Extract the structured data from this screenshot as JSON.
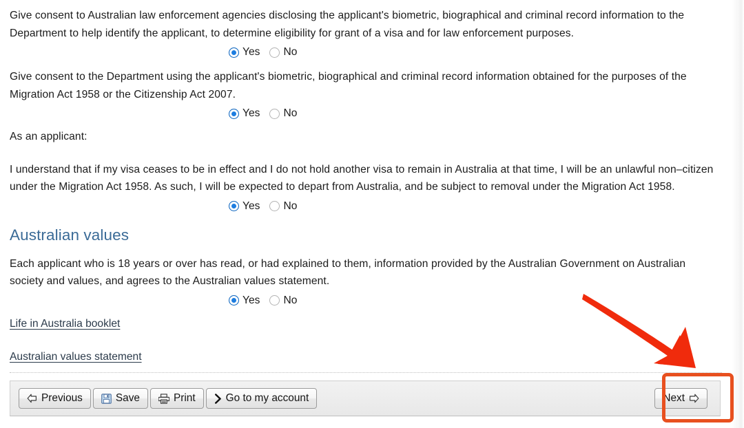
{
  "form": {
    "questions": [
      {
        "id": "consent-law-enforcement",
        "text": "Give consent to Australian law enforcement agencies disclosing the applicant's biometric, biographical and criminal record information to the Department to help identify the applicant, to determine eligibility for grant of a visa and for law enforcement purposes.",
        "options": [
          {
            "label": "Yes",
            "selected": true
          },
          {
            "label": "No",
            "selected": false
          }
        ]
      },
      {
        "id": "consent-department-use",
        "text": "Give consent to the Department using the applicant's biometric, biographical and criminal record information obtained for the purposes of the Migration Act 1958 or the Citizenship Act 2007.",
        "options": [
          {
            "label": "Yes",
            "selected": true
          },
          {
            "label": "No",
            "selected": false
          }
        ]
      }
    ],
    "applicant_intro": "As an applicant:",
    "declaration": {
      "id": "unlawful-non-citizen-declaration",
      "text": "I understand that if my visa ceases to be in effect and I do not hold another visa to remain in Australia at that time, I will be an unlawful non–citizen under the Migration Act 1958. As such, I will be expected to depart from Australia, and be subject to removal under the Migration Act 1958.",
      "options": [
        {
          "label": "Yes",
          "selected": true
        },
        {
          "label": "No",
          "selected": false
        }
      ]
    },
    "australian_values": {
      "heading": "Australian values",
      "text": "Each applicant who is 18 years or over has read, or had explained to them, information provided by the Australian Government on Australian society and values, and agrees to the Australian values statement.",
      "options": [
        {
          "label": "Yes",
          "selected": true
        },
        {
          "label": "No",
          "selected": false
        }
      ],
      "links": [
        {
          "label": "Life in Australia booklet",
          "name": "life-in-australia-booklet-link"
        },
        {
          "label": "Australian values statement",
          "name": "australian-values-statement-link"
        }
      ]
    }
  },
  "toolbar": {
    "previous_label": "Previous",
    "save_label": "Save",
    "print_label": "Print",
    "account_label": "Go to my account",
    "next_label": "Next",
    "icons": {
      "previous": "arrow-left-icon",
      "save": "floppy-disk-icon",
      "print": "printer-icon",
      "account": "chevron-right-icon",
      "next": "arrow-right-icon"
    }
  },
  "annotations": {
    "arrow": {
      "name": "red-pointer-arrow",
      "color": "#f02b0c",
      "points_to": "next-button"
    },
    "highlight": {
      "name": "next-button-highlight-box",
      "color": "#e8501f"
    }
  },
  "colors": {
    "heading": "#3b6b97",
    "link": "#2b3a4a",
    "radio_selected": "#1d7de0",
    "annotation_red": "#f02b0c",
    "annotation_orange": "#e8501f",
    "toolbar_bg": "#ededed"
  }
}
